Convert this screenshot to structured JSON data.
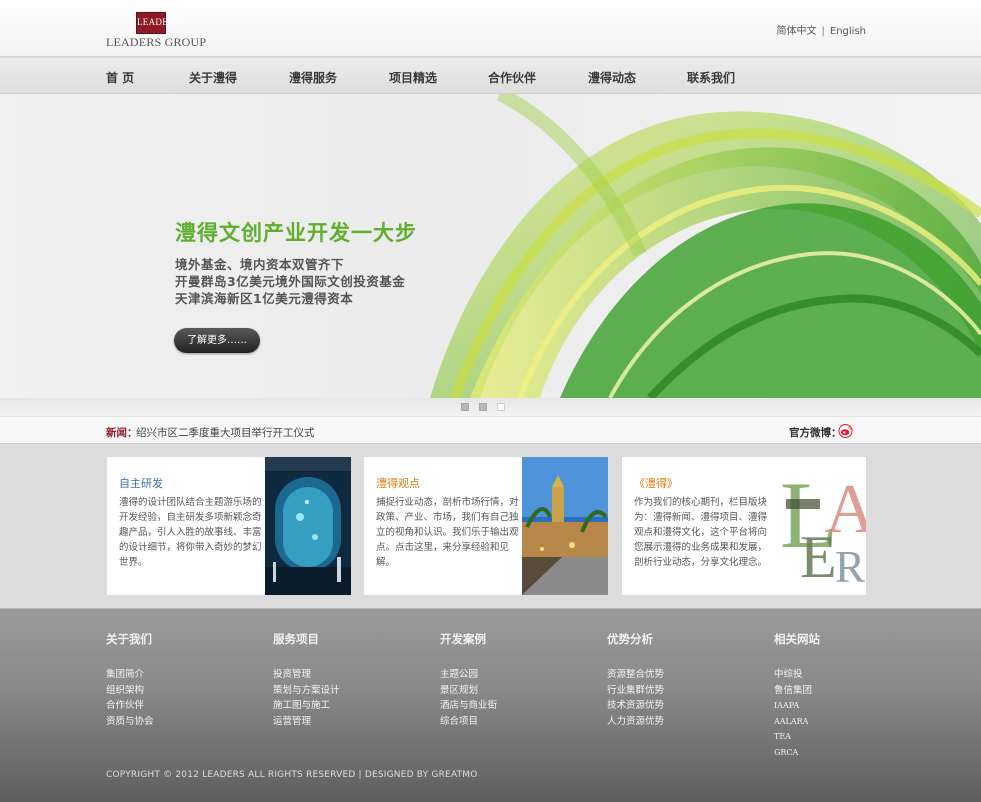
{
  "brand": {
    "logo_mark": "LEADERS",
    "logo_text": "LEADERS GROUP"
  },
  "lang": {
    "cn": "简体中文",
    "sep": "|",
    "en": "English"
  },
  "nav": {
    "items": [
      "首  页",
      "关于澧得",
      "澧得服务",
      "项目精选",
      "合作伙伴",
      "澧得动态",
      "联系我们"
    ]
  },
  "banner": {
    "title": "澧得文创产业开发一大步",
    "lines": [
      "境外基金、境内资本双管齐下",
      "开曼群岛3亿美元境外国际文创投资基金",
      "天津滨海新区1亿美元澧得资本"
    ],
    "button": "了解更多……"
  },
  "slider": {
    "dots": [
      {
        "active": false
      },
      {
        "active": false
      },
      {
        "active": true
      }
    ]
  },
  "news": {
    "label": "新闻：",
    "text": "绍兴市区二季度重大项目举行开工仪式",
    "weibo_label": "官方微博：",
    "weibo_icon": "weibo-icon"
  },
  "cards": [
    {
      "title": "自主研发",
      "title_color": "#3a6fa8",
      "text": "澧得的设计团队结合主题游乐场的开发经验，自主研发多项新颖念奇趣产品，引人入胜的故事线、丰富的设计细节，将你带入奇妙的梦幻世界。"
    },
    {
      "title": "澧得观点",
      "title_color": "#e07a10",
      "text": "捕捉行业动态，剖析市场行情，对政策、产业、市场，我们有自己独立的视角和认识。我们乐于输出观点。点击这里，来分享经验和见解。"
    },
    {
      "title": "《澧得》",
      "title_color": "#e07a10",
      "text": "作为我们的核心期刊，栏目版块为：澧得新闻、澧得项目、澧得观点和澧得文化，这个平台将向您展示澧得的业务成果和发展，剖析行业动态，分享文化理念。"
    }
  ],
  "footer": {
    "columns": [
      {
        "title": "关于我们",
        "links": [
          "集团简介",
          "组织架构",
          "合作伙伴",
          "资质与协会"
        ]
      },
      {
        "title": "服务项目",
        "links": [
          "投资管理",
          "策划与方案设计",
          "施工图与施工",
          "运营管理"
        ]
      },
      {
        "title": "开发案例",
        "links": [
          "主题公园",
          "景区规划",
          "酒店与商业街",
          "综合项目"
        ]
      },
      {
        "title": "优势分析",
        "links": [
          "资源整合优势",
          "行业集群优势",
          "技术资源优势",
          "人力资源优势"
        ]
      },
      {
        "title": "相关网站",
        "links": [
          "中综投",
          "鲁信集团",
          "IAAPA",
          "AALARA",
          "TEA",
          "GRCA"
        ]
      }
    ],
    "copyright": "COPYRIGHT © 2012  LEADERS  ALL RIGHTS RESERVED  |  DESIGNED BY GREATMO"
  },
  "colors": {
    "accent_green": "#5fae2e",
    "brand_red": "#8e1b27",
    "weibo_red": "#e6162d"
  }
}
